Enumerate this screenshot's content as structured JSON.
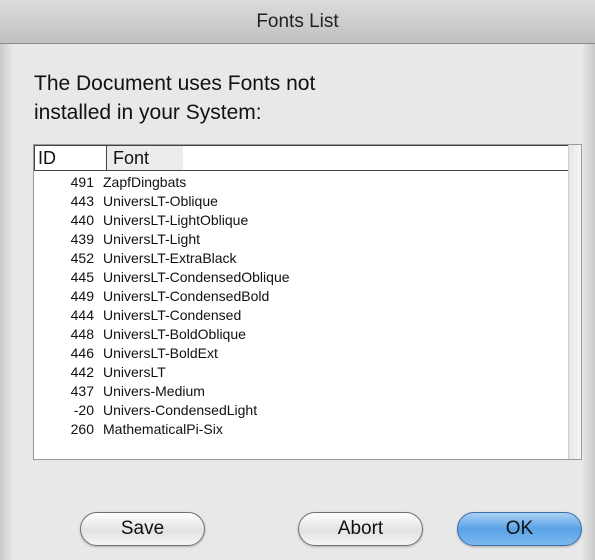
{
  "window": {
    "title": "Fonts List"
  },
  "message": {
    "line1": "The Document uses Fonts not",
    "line2": "installed in your System:"
  },
  "table": {
    "headers": {
      "id": "ID",
      "font": "Font"
    },
    "rows": [
      {
        "id": "491",
        "font": "ZapfDingbats"
      },
      {
        "id": "443",
        "font": "UniversLT-Oblique"
      },
      {
        "id": "440",
        "font": "UniversLT-LightOblique"
      },
      {
        "id": "439",
        "font": "UniversLT-Light"
      },
      {
        "id": "452",
        "font": "UniversLT-ExtraBlack"
      },
      {
        "id": "445",
        "font": "UniversLT-CondensedOblique"
      },
      {
        "id": "449",
        "font": "UniversLT-CondensedBold"
      },
      {
        "id": "444",
        "font": "UniversLT-Condensed"
      },
      {
        "id": "448",
        "font": "UniversLT-BoldOblique"
      },
      {
        "id": "446",
        "font": "UniversLT-BoldExt"
      },
      {
        "id": "442",
        "font": "UniversLT"
      },
      {
        "id": "437",
        "font": "Univers-Medium"
      },
      {
        "id": "-20",
        "font": "Univers-CondensedLight"
      },
      {
        "id": "260",
        "font": "MathematicalPi-Six"
      }
    ]
  },
  "buttons": {
    "save": "Save",
    "abort": "Abort",
    "ok": "OK"
  },
  "colors": {
    "default_button_accent": "#5aa2e6"
  }
}
